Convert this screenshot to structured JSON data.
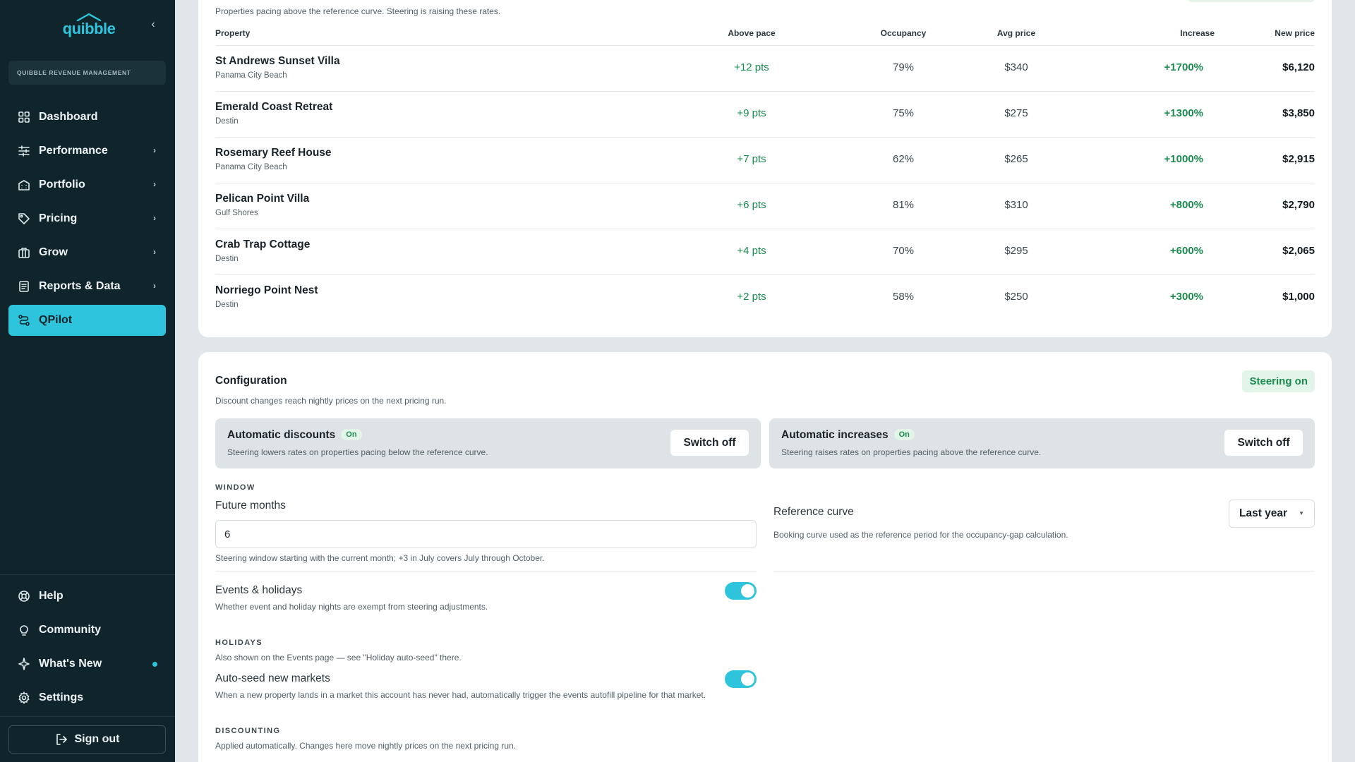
{
  "brand": {
    "name": "quibble",
    "accent": "#2ec4dc"
  },
  "sidebar": {
    "org_label": "QUIBBLE REVENUE MANAGEMENT",
    "items": [
      {
        "label": "Dashboard",
        "icon": "grid-icon",
        "chevron": false
      },
      {
        "label": "Performance",
        "icon": "sliders-icon",
        "chevron": true
      },
      {
        "label": "Portfolio",
        "icon": "building-icon",
        "chevron": true
      },
      {
        "label": "Pricing",
        "icon": "tag-icon",
        "chevron": true
      },
      {
        "label": "Grow",
        "icon": "briefcase-icon",
        "chevron": true
      },
      {
        "label": "Reports & Data",
        "icon": "report-icon",
        "chevron": true
      },
      {
        "label": "QPilot",
        "icon": "route-icon",
        "chevron": false,
        "active": true
      }
    ],
    "bottom_items": [
      {
        "label": "Help",
        "icon": "lifebuoy-icon"
      },
      {
        "label": "Community",
        "icon": "lightbulb-icon"
      },
      {
        "label": "What's New",
        "icon": "sparkle-icon",
        "dot": true
      },
      {
        "label": "Settings",
        "icon": "gear-icon"
      }
    ],
    "signout_label": "Sign out"
  },
  "pacing": {
    "subtitle": "Properties pacing above the reference curve. Steering is raising these rates.",
    "columns": [
      "Property",
      "Above pace",
      "Occupancy",
      "Avg price",
      "Increase",
      "New price"
    ],
    "rows": [
      {
        "name": "St Andrews Sunset Villa",
        "location": "Panama City Beach",
        "above": "+12 pts",
        "occupancy": "79%",
        "avg": "$340",
        "increase": "+1700%",
        "new_price": "$6,120"
      },
      {
        "name": "Emerald Coast Retreat",
        "location": "Destin",
        "above": "+9 pts",
        "occupancy": "75%",
        "avg": "$275",
        "increase": "+1300%",
        "new_price": "$3,850"
      },
      {
        "name": "Rosemary Reef House",
        "location": "Panama City Beach",
        "above": "+7 pts",
        "occupancy": "62%",
        "avg": "$265",
        "increase": "+1000%",
        "new_price": "$2,915"
      },
      {
        "name": "Pelican Point Villa",
        "location": "Gulf Shores",
        "above": "+6 pts",
        "occupancy": "81%",
        "avg": "$310",
        "increase": "+800%",
        "new_price": "$2,790"
      },
      {
        "name": "Crab Trap Cottage",
        "location": "Destin",
        "above": "+4 pts",
        "occupancy": "70%",
        "avg": "$295",
        "increase": "+600%",
        "new_price": "$2,065"
      },
      {
        "name": "Norriego Point Nest",
        "location": "Destin",
        "above": "+2 pts",
        "occupancy": "58%",
        "avg": "$250",
        "increase": "+300%",
        "new_price": "$1,000"
      }
    ]
  },
  "config": {
    "title": "Configuration",
    "subtitle": "Discount changes reach nightly prices on the next pricing run.",
    "steering_badge": "Steering on",
    "auto_discounts": {
      "title": "Automatic discounts",
      "status": "On",
      "desc": "Steering lowers rates on properties pacing below the reference curve.",
      "button": "Switch off"
    },
    "auto_increases": {
      "title": "Automatic increases",
      "status": "On",
      "desc": "Steering raises rates on properties pacing above the reference curve.",
      "button": "Switch off"
    },
    "window": {
      "section": "WINDOW",
      "future_label": "Future months",
      "future_value": "6",
      "future_help": "Steering window starting with the current month; +3 in July covers July through October.",
      "ref_label": "Reference curve",
      "ref_value": "Last year",
      "ref_help": "Booking curve used as the reference period for the occupancy-gap calculation."
    },
    "events": {
      "label": "Events & holidays",
      "help": "Whether event and holiday nights are exempt from steering adjustments.",
      "enabled": true
    },
    "holidays": {
      "section": "HOLIDAYS",
      "note": "Also shown on the Events page — see \"Holiday auto-seed\" there.",
      "auto_label": "Auto-seed new markets",
      "auto_help": "When a new property lands in a market this account has never had, automatically trigger the events autofill pipeline for that market.",
      "enabled": true
    },
    "discounting": {
      "section": "DISCOUNTING",
      "help": "Applied automatically. Changes here move nightly prices on the next pricing run."
    }
  }
}
